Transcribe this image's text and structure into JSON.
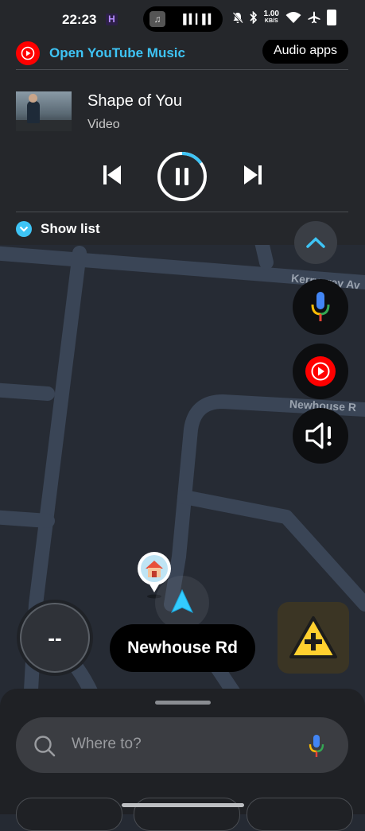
{
  "status_bar": {
    "time": "22:23",
    "notif_badge": "H",
    "net_speed_value": "1.00",
    "net_speed_unit": "KB/S",
    "icons": [
      "silent-bell-icon",
      "bluetooth-icon",
      "wifi-icon",
      "airplane-icon",
      "battery-icon"
    ]
  },
  "media_panel": {
    "open_app_label": "Open YouTube Music",
    "audio_apps_label": "Audio apps",
    "track_title": "Shape of You",
    "track_subtitle": "Video",
    "progress_fraction": 0.15,
    "show_list_label": "Show list",
    "accent_color": "#3ec4f5"
  },
  "map": {
    "street_labels": [
      "Kerrygrey Av",
      "Newhouse R"
    ],
    "current_street": "Newhouse Rd",
    "speed": "--"
  },
  "bottom_sheet": {
    "search_placeholder": "Where to?"
  },
  "colors": {
    "youtube_red": "#ff0000",
    "report_yellow": "#ffd02f",
    "map_background": "#252a33",
    "road": "#3b4658"
  }
}
